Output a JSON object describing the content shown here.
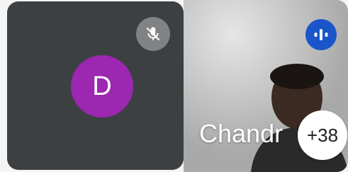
{
  "participants": [
    {
      "initial": "D",
      "avatar_color": "#9c27b0",
      "muted": true,
      "status_icon": "mic-off-icon"
    },
    {
      "name": "Chandr",
      "speaking": true,
      "status_icon": "audio-wave-icon",
      "accent": "#1a56c9"
    }
  ],
  "overflow": {
    "label": "+38"
  },
  "colors": {
    "tile_background": "#3c4043"
  }
}
